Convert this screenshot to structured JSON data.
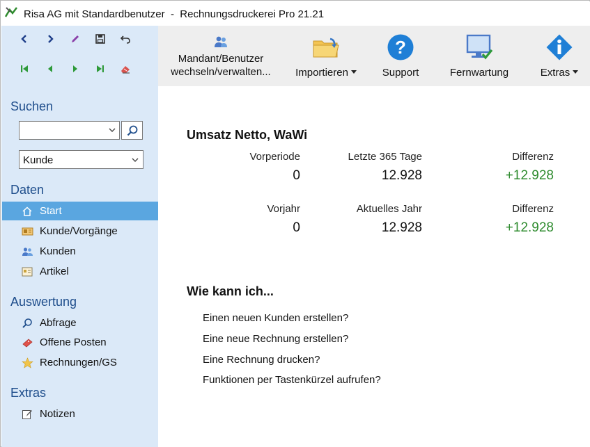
{
  "window": {
    "title": "Risa AG mit Standardbenutzer  -  Rechnungsdruckerei Pro 21.21"
  },
  "sidebar": {
    "search_title": "Suchen",
    "search_value": "",
    "select_value": "Kunde",
    "sections": {
      "daten": "Daten",
      "auswertung": "Auswertung",
      "extras": "Extras"
    },
    "daten_items": [
      {
        "label": "Start",
        "icon": "home-icon"
      },
      {
        "label": "Kunde/Vorgänge",
        "icon": "customer-card-icon"
      },
      {
        "label": "Kunden",
        "icon": "users-icon"
      },
      {
        "label": "Artikel",
        "icon": "article-icon"
      }
    ],
    "auswertung_items": [
      {
        "label": "Abfrage",
        "icon": "magnifier-icon"
      },
      {
        "label": "Offene Posten",
        "icon": "ticket-icon"
      },
      {
        "label": "Rechnungen/GS",
        "icon": "star-icon"
      }
    ],
    "extras_items": [
      {
        "label": "Notizen",
        "icon": "note-edit-icon"
      }
    ]
  },
  "toolbar": {
    "mandant_line1": "Mandant/Benutzer",
    "mandant_line2": "wechseln/verwalten...",
    "importieren": "Importieren",
    "support": "Support",
    "fernwartung": "Fernwartung",
    "extras": "Extras"
  },
  "main": {
    "umsatz_title": "Umsatz Netto, WaWi",
    "row1": {
      "label_a": "Vorperiode",
      "value_a": "0",
      "label_b": "Letzte 365 Tage",
      "value_b": "12.928",
      "label_c": "Differenz",
      "value_c": "+12.928"
    },
    "row2": {
      "label_a": "Vorjahr",
      "value_a": "0",
      "label_b": "Aktuelles Jahr",
      "value_b": "12.928",
      "label_c": "Differenz",
      "value_c": "+12.928"
    },
    "howto_title": "Wie kann ich...",
    "links": [
      "Einen neuen Kunden erstellen?",
      "Eine neue Rechnung erstellen?",
      "Eine Rechnung drucken?",
      "Funktionen per Tastenkürzel aufrufen?"
    ]
  },
  "colors": {
    "sidebar_bg": "#dbe9f8",
    "accent": "#5aa6e0",
    "section_title": "#1f4e8c",
    "positive": "#2e8b2e",
    "toolbar_bg": "#eeeeee"
  }
}
